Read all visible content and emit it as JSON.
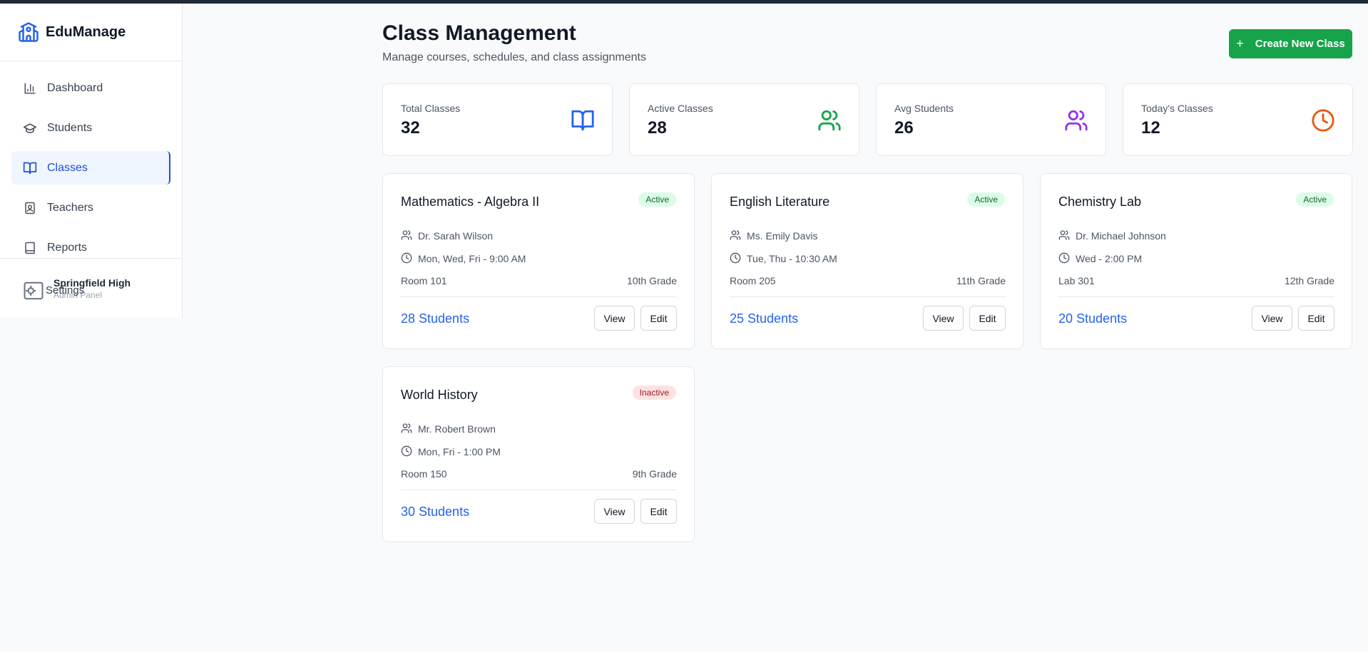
{
  "app": {
    "name": "EduManage"
  },
  "sidebar": {
    "items": [
      {
        "label": "Dashboard",
        "icon": "bar-chart-icon",
        "active": false
      },
      {
        "label": "Students",
        "icon": "graduation-cap-icon",
        "active": false
      },
      {
        "label": "Classes",
        "icon": "book-open-icon",
        "active": true
      },
      {
        "label": "Teachers",
        "icon": "contact-icon",
        "active": false
      },
      {
        "label": "Reports",
        "icon": "book-icon",
        "active": false
      }
    ],
    "footer": {
      "name": "Springfield High",
      "subtitle": "Admin Panel",
      "settings_label": "Settings"
    }
  },
  "header": {
    "title": "Class Management",
    "subtitle": "Manage courses, schedules, and class assignments",
    "create_label": "Create New Class"
  },
  "stats": [
    {
      "label": "Total Classes",
      "value": "32",
      "icon": "book-open-icon",
      "color": "#2563eb"
    },
    {
      "label": "Active Classes",
      "value": "28",
      "icon": "users-icon",
      "color": "#16a34a"
    },
    {
      "label": "Avg Students",
      "value": "26",
      "icon": "users-icon",
      "color": "#9333ea"
    },
    {
      "label": "Today's Classes",
      "value": "12",
      "icon": "clock-icon",
      "color": "#ea580c"
    }
  ],
  "classes": [
    {
      "title": "Mathematics - Algebra II",
      "status": "Active",
      "teacher": "Dr. Sarah Wilson",
      "schedule": "Mon, Wed, Fri - 9:00 AM",
      "room": "Room 101",
      "grade": "10th Grade",
      "students": "28 Students",
      "view_label": "View",
      "edit_label": "Edit"
    },
    {
      "title": "English Literature",
      "status": "Active",
      "teacher": "Ms. Emily Davis",
      "schedule": "Tue, Thu - 10:30 AM",
      "room": "Room 205",
      "grade": "11th Grade",
      "students": "25 Students",
      "view_label": "View",
      "edit_label": "Edit"
    },
    {
      "title": "Chemistry Lab",
      "status": "Active",
      "teacher": "Dr. Michael Johnson",
      "schedule": "Wed - 2:00 PM",
      "room": "Lab 301",
      "grade": "12th Grade",
      "students": "20 Students",
      "view_label": "View",
      "edit_label": "Edit"
    },
    {
      "title": "World History",
      "status": "Inactive",
      "teacher": "Mr. Robert Brown",
      "schedule": "Mon, Fri - 1:00 PM",
      "room": "Room 150",
      "grade": "9th Grade",
      "students": "30 Students",
      "view_label": "View",
      "edit_label": "Edit"
    }
  ],
  "colors": {
    "brand": "#2563eb",
    "accent_green": "#16a34a"
  }
}
